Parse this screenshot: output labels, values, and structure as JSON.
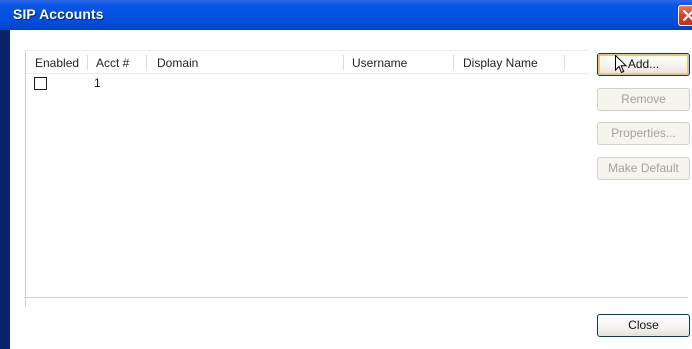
{
  "window": {
    "title": "SIP Accounts"
  },
  "table": {
    "columns": [
      "Enabled",
      "Acct #",
      "Domain",
      "Username",
      "Display Name"
    ],
    "rows": [
      {
        "enabled": false,
        "acct": "1",
        "domain": "",
        "username": "",
        "display_name": ""
      }
    ]
  },
  "buttons": {
    "add": "Add...",
    "remove": "Remove",
    "properties": "Properties...",
    "make_default": "Make Default",
    "close": "Close"
  },
  "icons": {
    "close": "close-icon",
    "cursor": "mouse-pointer-icon",
    "checkbox": "checkbox-unchecked-icon"
  },
  "colors": {
    "titlebar": "#0054e3",
    "close_button": "#d6402a",
    "button_border": "#003c74",
    "default_focus": "#f3c26a",
    "disabled_text": "#a6a395"
  }
}
